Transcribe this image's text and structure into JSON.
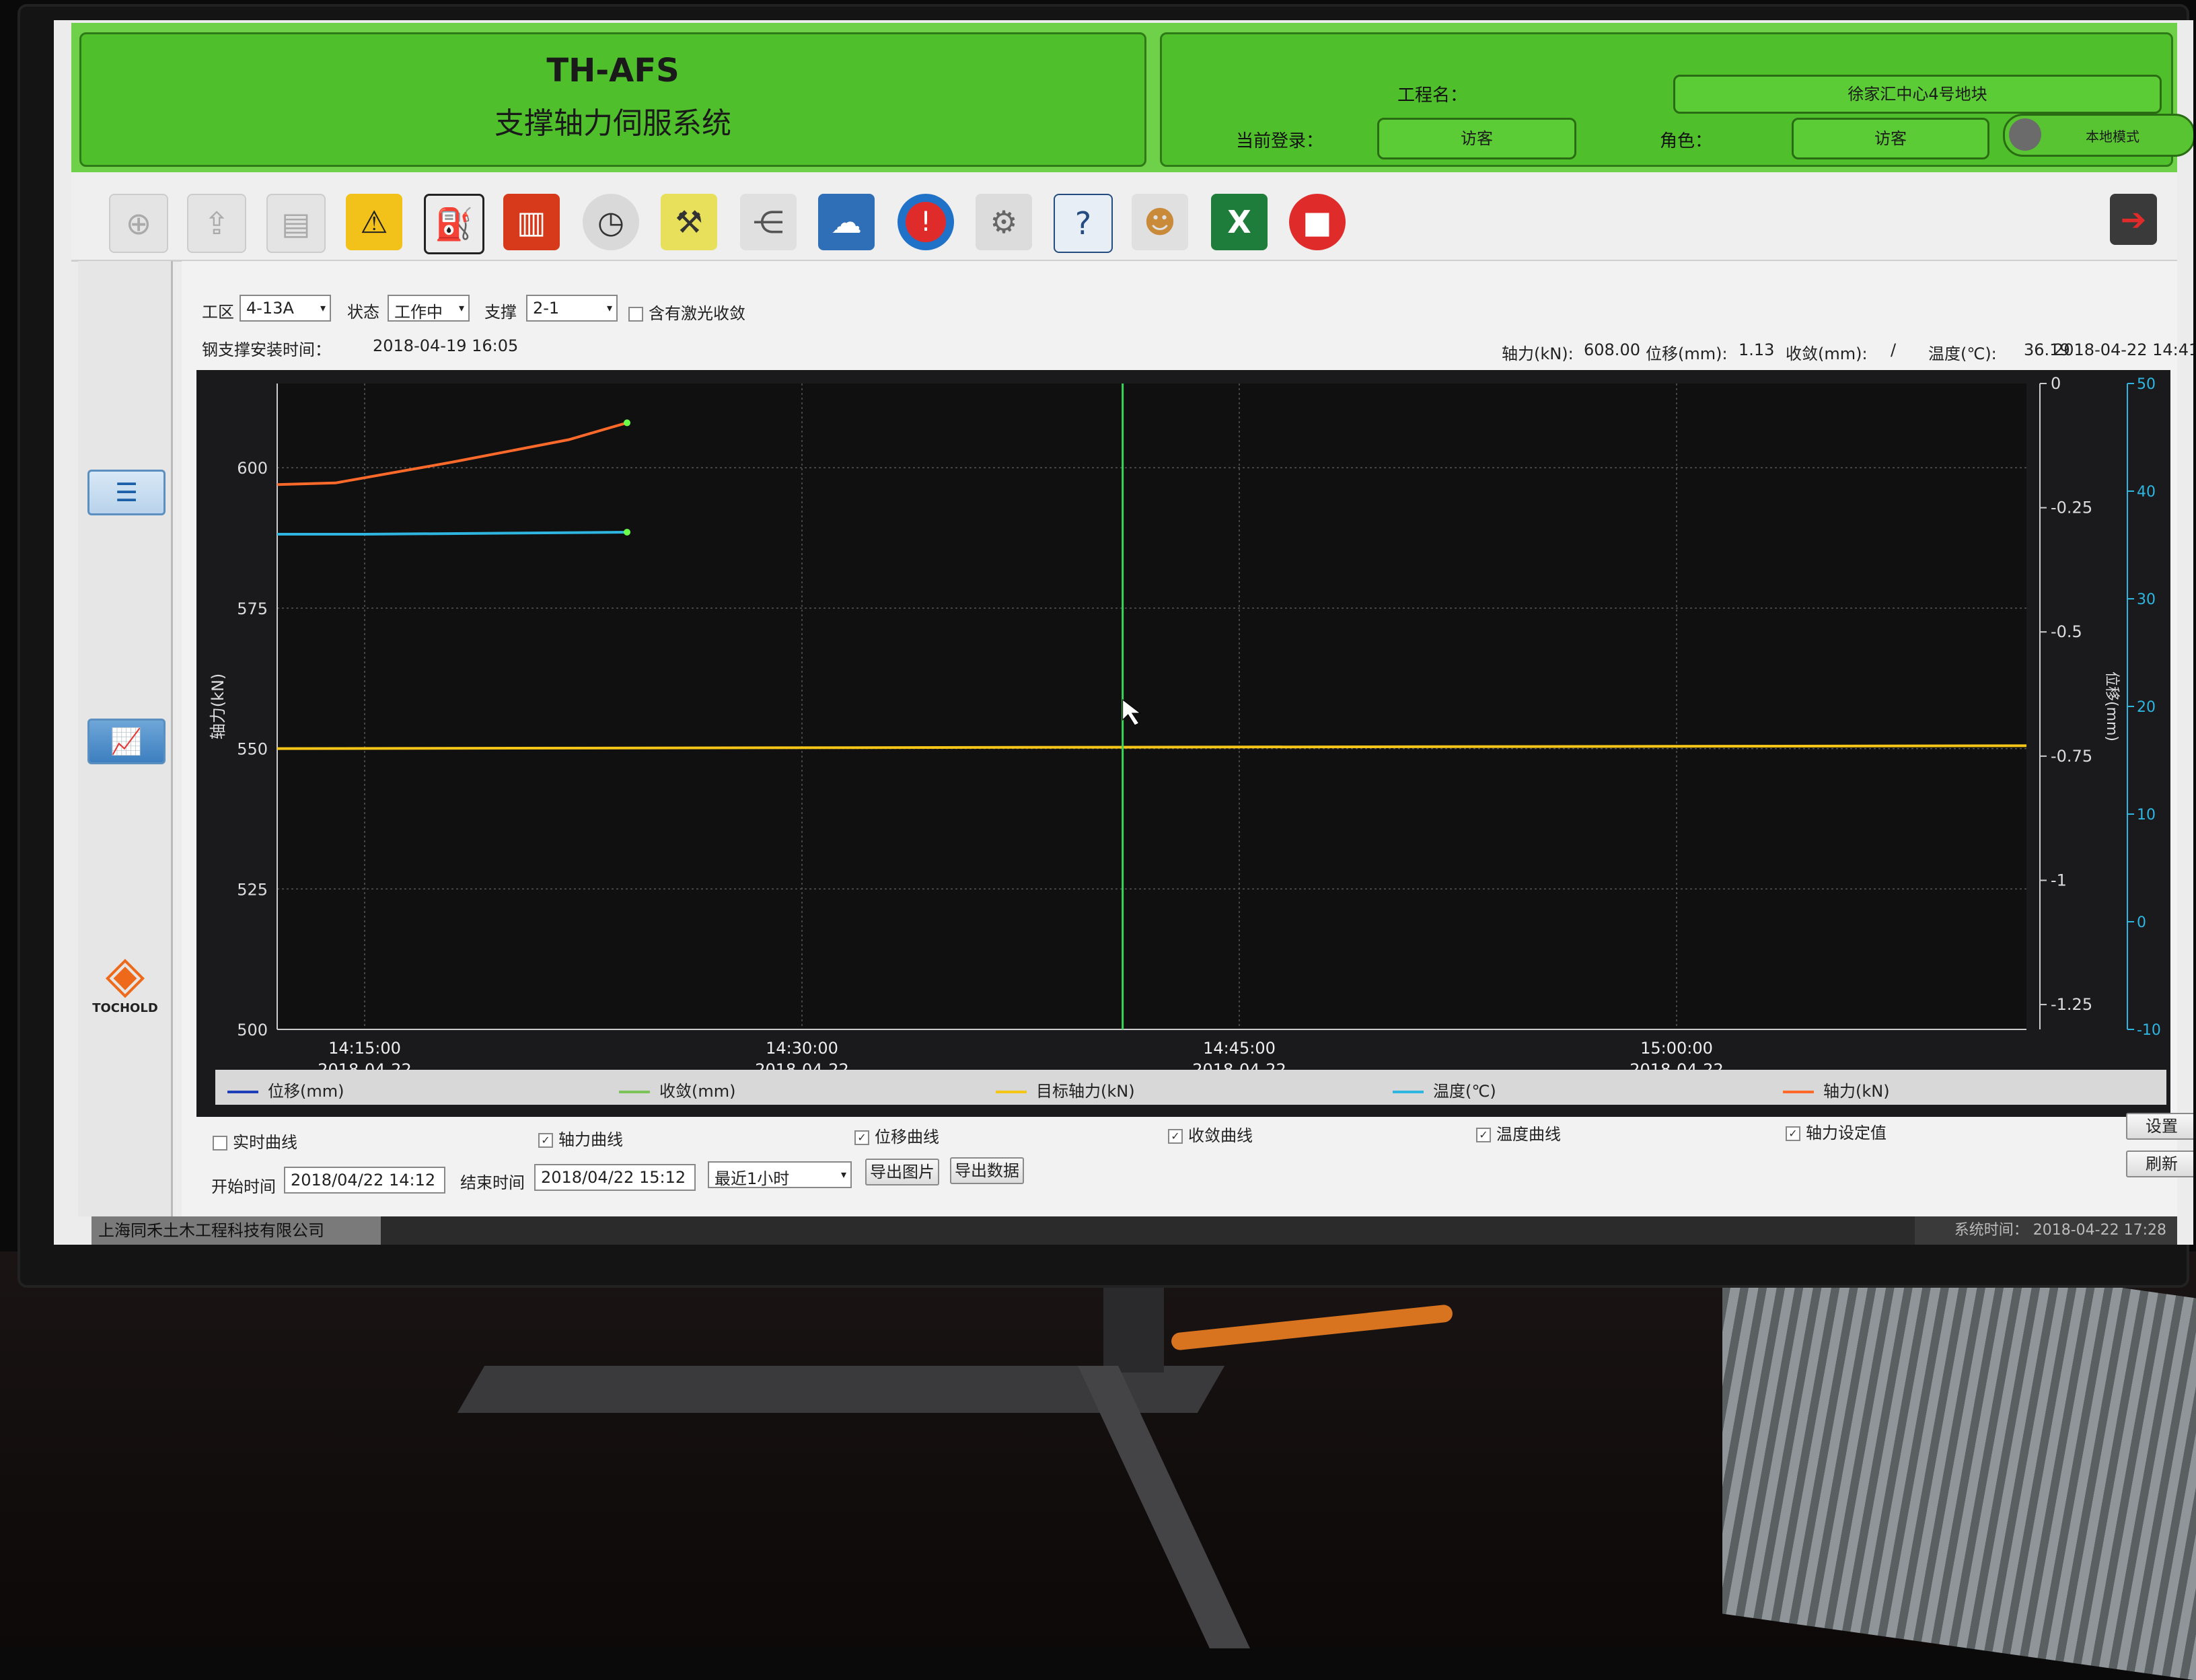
{
  "header": {
    "app_code": "TH-AFS",
    "app_name": "支撑轴力伺服系统",
    "project_label": "工程名：",
    "project_value": "徐家汇中心4号地块",
    "login_label": "当前登录：",
    "login_value": "访客",
    "role_label": "角色：",
    "role_value": "访客",
    "mode_label": "本地模式"
  },
  "toolbar": {
    "icons": [
      "new-file-icon",
      "open-folder-icon",
      "document-icon",
      "construction-barrier-icon",
      "fuel-pump-icon",
      "hydraulic-unit-icon",
      "gauge-icon",
      "jack-icon",
      "share-icon",
      "cloud-download-icon",
      "alarm-icon",
      "settings-gear-icon",
      "help-icon",
      "user-icon",
      "excel-icon",
      "stop-icon",
      "exit-icon"
    ]
  },
  "filters": {
    "zone_label": "工区",
    "zone_value": "4-13A",
    "state_label": "状态",
    "state_value": "工作中",
    "support_label": "支撑",
    "support_value": "2-1",
    "laser_label": "含有激光收敛",
    "install_label": "钢支撑安装时间：",
    "install_value": "2018-04-19 16:05"
  },
  "readout": {
    "axial_label": "轴力(kN):",
    "axial_value": "608.00",
    "disp_label": "位移(mm):",
    "disp_value": "1.13",
    "conv_label": "收敛(mm):",
    "conv_value": "/",
    "temp_label": "温度(℃):",
    "temp_value": "36.19",
    "time_value": "2018-04-22 14:41"
  },
  "chart_data": {
    "type": "line",
    "x_ticks": [
      {
        "time": "14:15:00",
        "date": "2018-04-22"
      },
      {
        "time": "14:30:00",
        "date": "2018-04-22"
      },
      {
        "time": "14:45:00",
        "date": "2018-04-22"
      },
      {
        "time": "15:00:00",
        "date": "2018-04-22"
      }
    ],
    "x_range": [
      "2018-04-22 14:12",
      "2018-04-22 15:12"
    ],
    "y_left": {
      "label": "轴力(kN)",
      "range": [
        500,
        615
      ],
      "ticks": [
        500,
        525,
        550,
        575,
        600
      ]
    },
    "y_right1": {
      "label": "位移(mm)",
      "range": [
        -1.3,
        0
      ],
      "ticks": [
        "0",
        "-0.25",
        "-0.5",
        "-0.75",
        "-1",
        "-1.25"
      ]
    },
    "y_right2": {
      "label": "温度(℃)",
      "range": [
        -10,
        50
      ],
      "ticks": [
        "50",
        "40",
        "30",
        "20",
        "10",
        "0",
        "-10"
      ]
    },
    "series": [
      {
        "name": "轴力(kN)",
        "color": "#ff6a2a",
        "axis": "left",
        "points": [
          [
            "14:12",
            597
          ],
          [
            "14:14",
            597.3
          ],
          [
            "14:18",
            601
          ],
          [
            "14:22",
            605
          ],
          [
            "14:24",
            608
          ]
        ]
      },
      {
        "name": "温度(℃)",
        "color": "#2fb6e0",
        "axis": "right2",
        "points": [
          [
            "14:12",
            36.0
          ],
          [
            "14:15",
            36.0
          ],
          [
            "14:20",
            36.1
          ],
          [
            "14:24",
            36.19
          ]
        ]
      },
      {
        "name": "目标轴力(kN)",
        "color": "#f5c518",
        "axis": "left",
        "points": [
          [
            "14:12",
            550
          ],
          [
            "15:12",
            550.5
          ]
        ]
      }
    ],
    "cursor_time": "14:41",
    "legend": [
      {
        "name": "位移(mm)",
        "color": "#1f3fb8"
      },
      {
        "name": "收敛(mm)",
        "color": "#7cc35a"
      },
      {
        "name": "目标轴力(kN)",
        "color": "#f5c518"
      },
      {
        "name": "温度(℃)",
        "color": "#2fb6e0"
      },
      {
        "name": "轴力(kN)",
        "color": "#ff6a2a"
      }
    ]
  },
  "options": {
    "realtime": "实时曲线",
    "axial": "轴力曲线",
    "disp": "位移曲线",
    "conv": "收敛曲线",
    "temp": "温度曲线",
    "target": "轴力设定值"
  },
  "controls": {
    "start_label": "开始时间",
    "start_value": "2018/04/22 14:12",
    "end_label": "结束时间",
    "end_value": "2018/04/22 15:12",
    "range_value": "最近1小时",
    "export_image": "导出图片",
    "export_data": "导出数据",
    "settings": "设置",
    "refresh": "刷新"
  },
  "status": {
    "company": "上海同禾土木工程科技有限公司",
    "sys_time": "系统时间：  2018-04-22 17:28"
  },
  "logo": {
    "word": "TOCHOLD"
  }
}
